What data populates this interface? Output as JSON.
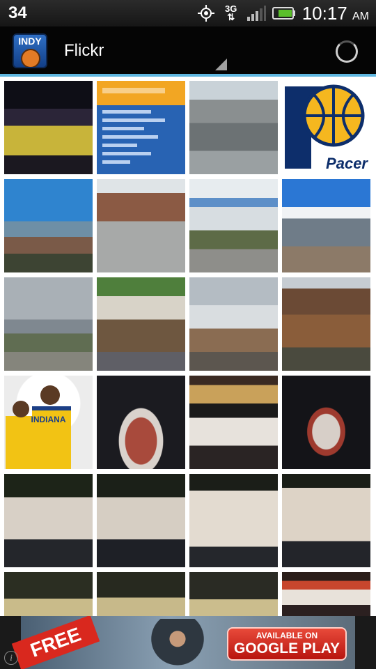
{
  "status_bar": {
    "notification_count": "34",
    "network": "3G",
    "time": "10:17",
    "ampm": "AM",
    "icons": [
      "gps-icon",
      "network-3g-icon",
      "signal-icon",
      "battery-icon"
    ]
  },
  "action_bar": {
    "app_icon_text": "INDY",
    "title": "Flickr",
    "icons": [
      "app-logo-icon",
      "spinner-dropdown-icon",
      "progress-spinner-icon"
    ]
  },
  "colors": {
    "accent": "#5fb7e0",
    "actionbar_bg": "#050505",
    "grid_bg": "#ffffff"
  },
  "photos": [
    {
      "name": "arena-court-night",
      "text": ""
    },
    {
      "name": "indiana-fever-poster",
      "text": ""
    },
    {
      "name": "city-rooftops",
      "text": ""
    },
    {
      "name": "pacers-logo",
      "text": "Pacer"
    },
    {
      "name": "stadium-skyline",
      "text": ""
    },
    {
      "name": "arena-exterior",
      "text": ""
    },
    {
      "name": "park-clouds",
      "text": ""
    },
    {
      "name": "arena-blue-sky",
      "text": ""
    },
    {
      "name": "street-lamps",
      "text": ""
    },
    {
      "name": "pedal-bike-tour",
      "text": ""
    },
    {
      "name": "monument-circle",
      "text": ""
    },
    {
      "name": "downtown-buildings",
      "text": ""
    },
    {
      "name": "pacers-players-art",
      "text": "INDIANA"
    },
    {
      "name": "court-dark-1",
      "text": ""
    },
    {
      "name": "scoreboard",
      "text": ""
    },
    {
      "name": "court-dark-2",
      "text": ""
    },
    {
      "name": "game-action-1",
      "text": ""
    },
    {
      "name": "game-action-2",
      "text": ""
    },
    {
      "name": "game-action-3",
      "text": ""
    },
    {
      "name": "game-action-4",
      "text": ""
    },
    {
      "name": "game-partial-1",
      "text": ""
    },
    {
      "name": "game-partial-2",
      "text": ""
    },
    {
      "name": "game-partial-3",
      "text": ""
    },
    {
      "name": "scoreboard-partial",
      "text": ""
    }
  ],
  "ad": {
    "badge": "FREE",
    "cta_line1": "AVAILABLE ON",
    "cta_line2": "GOOGLE PLAY",
    "info": "i"
  }
}
